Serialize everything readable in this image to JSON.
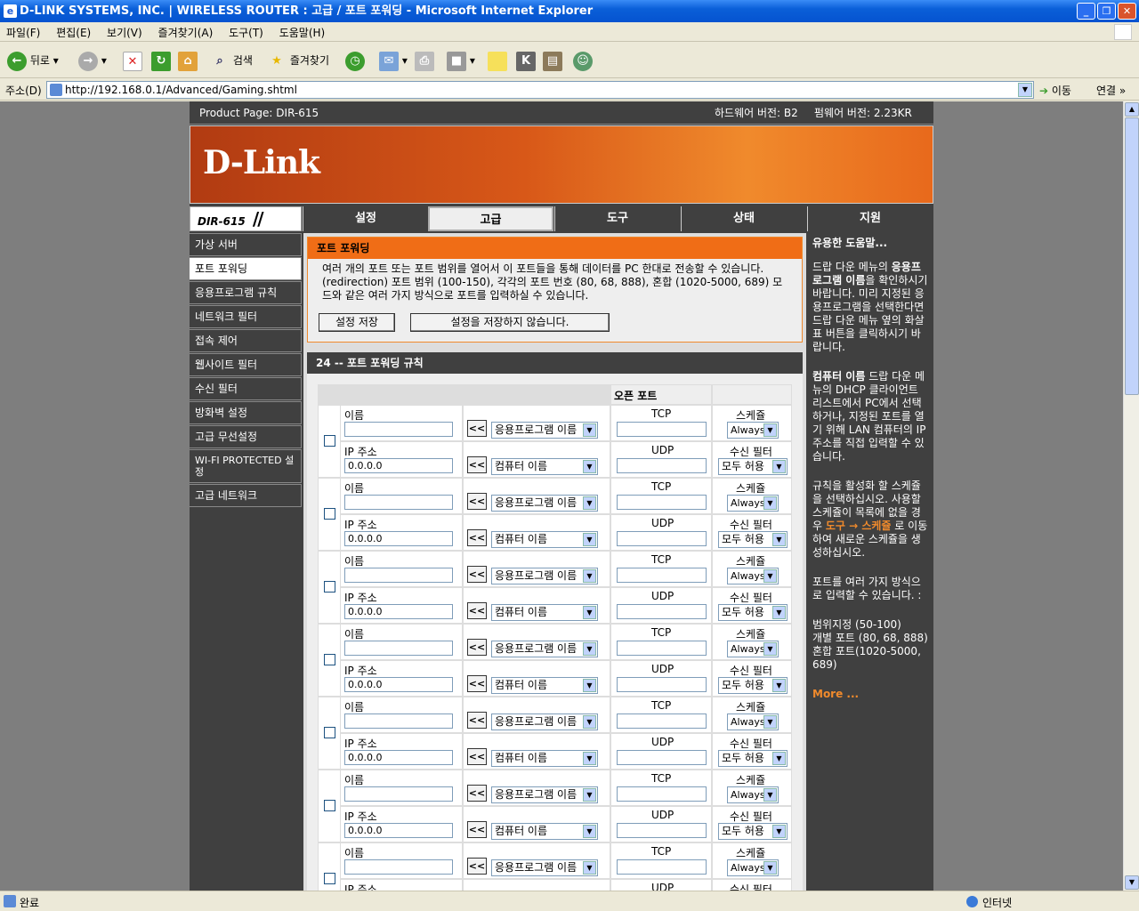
{
  "window": {
    "title": "D-LINK SYSTEMS, INC. | WIRELESS ROUTER : 고급 / 포트 포워딩 - Microsoft Internet Explorer",
    "minimize": "_",
    "maximize": "❐",
    "close": "✕"
  },
  "menu": [
    "파일(F)",
    "편집(E)",
    "보기(V)",
    "즐겨찾기(A)",
    "도구(T)",
    "도움말(H)"
  ],
  "toolbar": {
    "back": "뒤로",
    "search": "검색",
    "favorites": "즐겨찾기"
  },
  "address": {
    "label": "주소(D)",
    "url": "http://192.168.0.1/Advanced/Gaming.shtml",
    "go": "이동",
    "links": "연결"
  },
  "status": {
    "text": "완료",
    "zone": "인터넷"
  },
  "router": {
    "product": "Product Page: DIR-615",
    "hw": "하드웨어 버전: B2",
    "fw": "펌웨어 버전: 2.23KR",
    "logo": "D-Link",
    "model": "DIR-615",
    "tabs": [
      "설정",
      "고급",
      "도구",
      "상태",
      "지원"
    ],
    "active_tab": 1,
    "leftnav": [
      "가상 서버",
      "포트 포워딩",
      "응용프로그램 규칙",
      "네트워크 필터",
      "접속 제어",
      "웹사이트 필터",
      "수신 필터",
      "방화벽 설정",
      "고급 무선설정",
      "WI-FI PROTECTED 설정",
      "고급 네트워크"
    ],
    "active_nav": 1
  },
  "intro": {
    "title": "포트 포워딩",
    "text": "여러 개의 포트 또는 포트 범위를 열어서 이 포트들을 통해 데이터를 PC 한대로 전송할 수 있습니다.(redirection) 포트 범위 (100-150), 각각의 포트 번호 (80, 68, 888), 혼합 (1020-5000, 689) 모드와 같은 여러 가지 방식으로 포트를 입력하실 수 있습니다.",
    "save": "설정 저장",
    "dont_save": "설정을 저장하지 않습니다."
  },
  "rules": {
    "title": "24 -- 포트 포워딩 규칙",
    "open_port": "오픈 포트",
    "name_label": "이름",
    "ip_label": "IP 주소",
    "ip_value": "0.0.0.0",
    "arrow": "<<",
    "app_select": "응용프로그램 이름",
    "pc_select": "컴퓨터 이름",
    "tcp": "TCP",
    "udp": "UDP",
    "schedule_label": "스케쥴",
    "schedule_value": "Always",
    "filter_label": "수신 필터",
    "filter_value": "모두 허용"
  },
  "help": {
    "title": "유용한 도움말...",
    "p1a": "드랍 다운 메뉴의 ",
    "p1b": "응용프로그램 이름",
    "p1c": "을 확인하시기 바랍니다. 미리 지정된 응용프로그램을 선택한다면 드랍 다운 메뉴 옆의 화살표 버튼을 클릭하시기 바랍니다.",
    "p2a": "컴퓨터 이름",
    "p2b": " 드랍 다운 메뉴의 DHCP 클라이언트 리스트에서 PC에서 선택하거나, 지정된 포트를 열기 위해 LAN 컴퓨터의 IP 주소를 직접 입력할 수 있습니다.",
    "p3a": "규칙을 활성화 할 스케쥴을 선택하십시오. 사용할 스케쥴이 목록에 없을 경우 ",
    "p3b": "도구 → 스케쥴",
    "p3c": " 로 이동하여 새로운 스케쥴을 생성하십시오.",
    "p4": "포트를 여러 가지 방식으로 입력할 수 있습니다. :",
    "p5a": "범위지정 (50-100)",
    "p5b": "개별 포트 (80, 68, 888)",
    "p5c": "혼합 포트(1020-5000, 689)",
    "more": "More ..."
  }
}
